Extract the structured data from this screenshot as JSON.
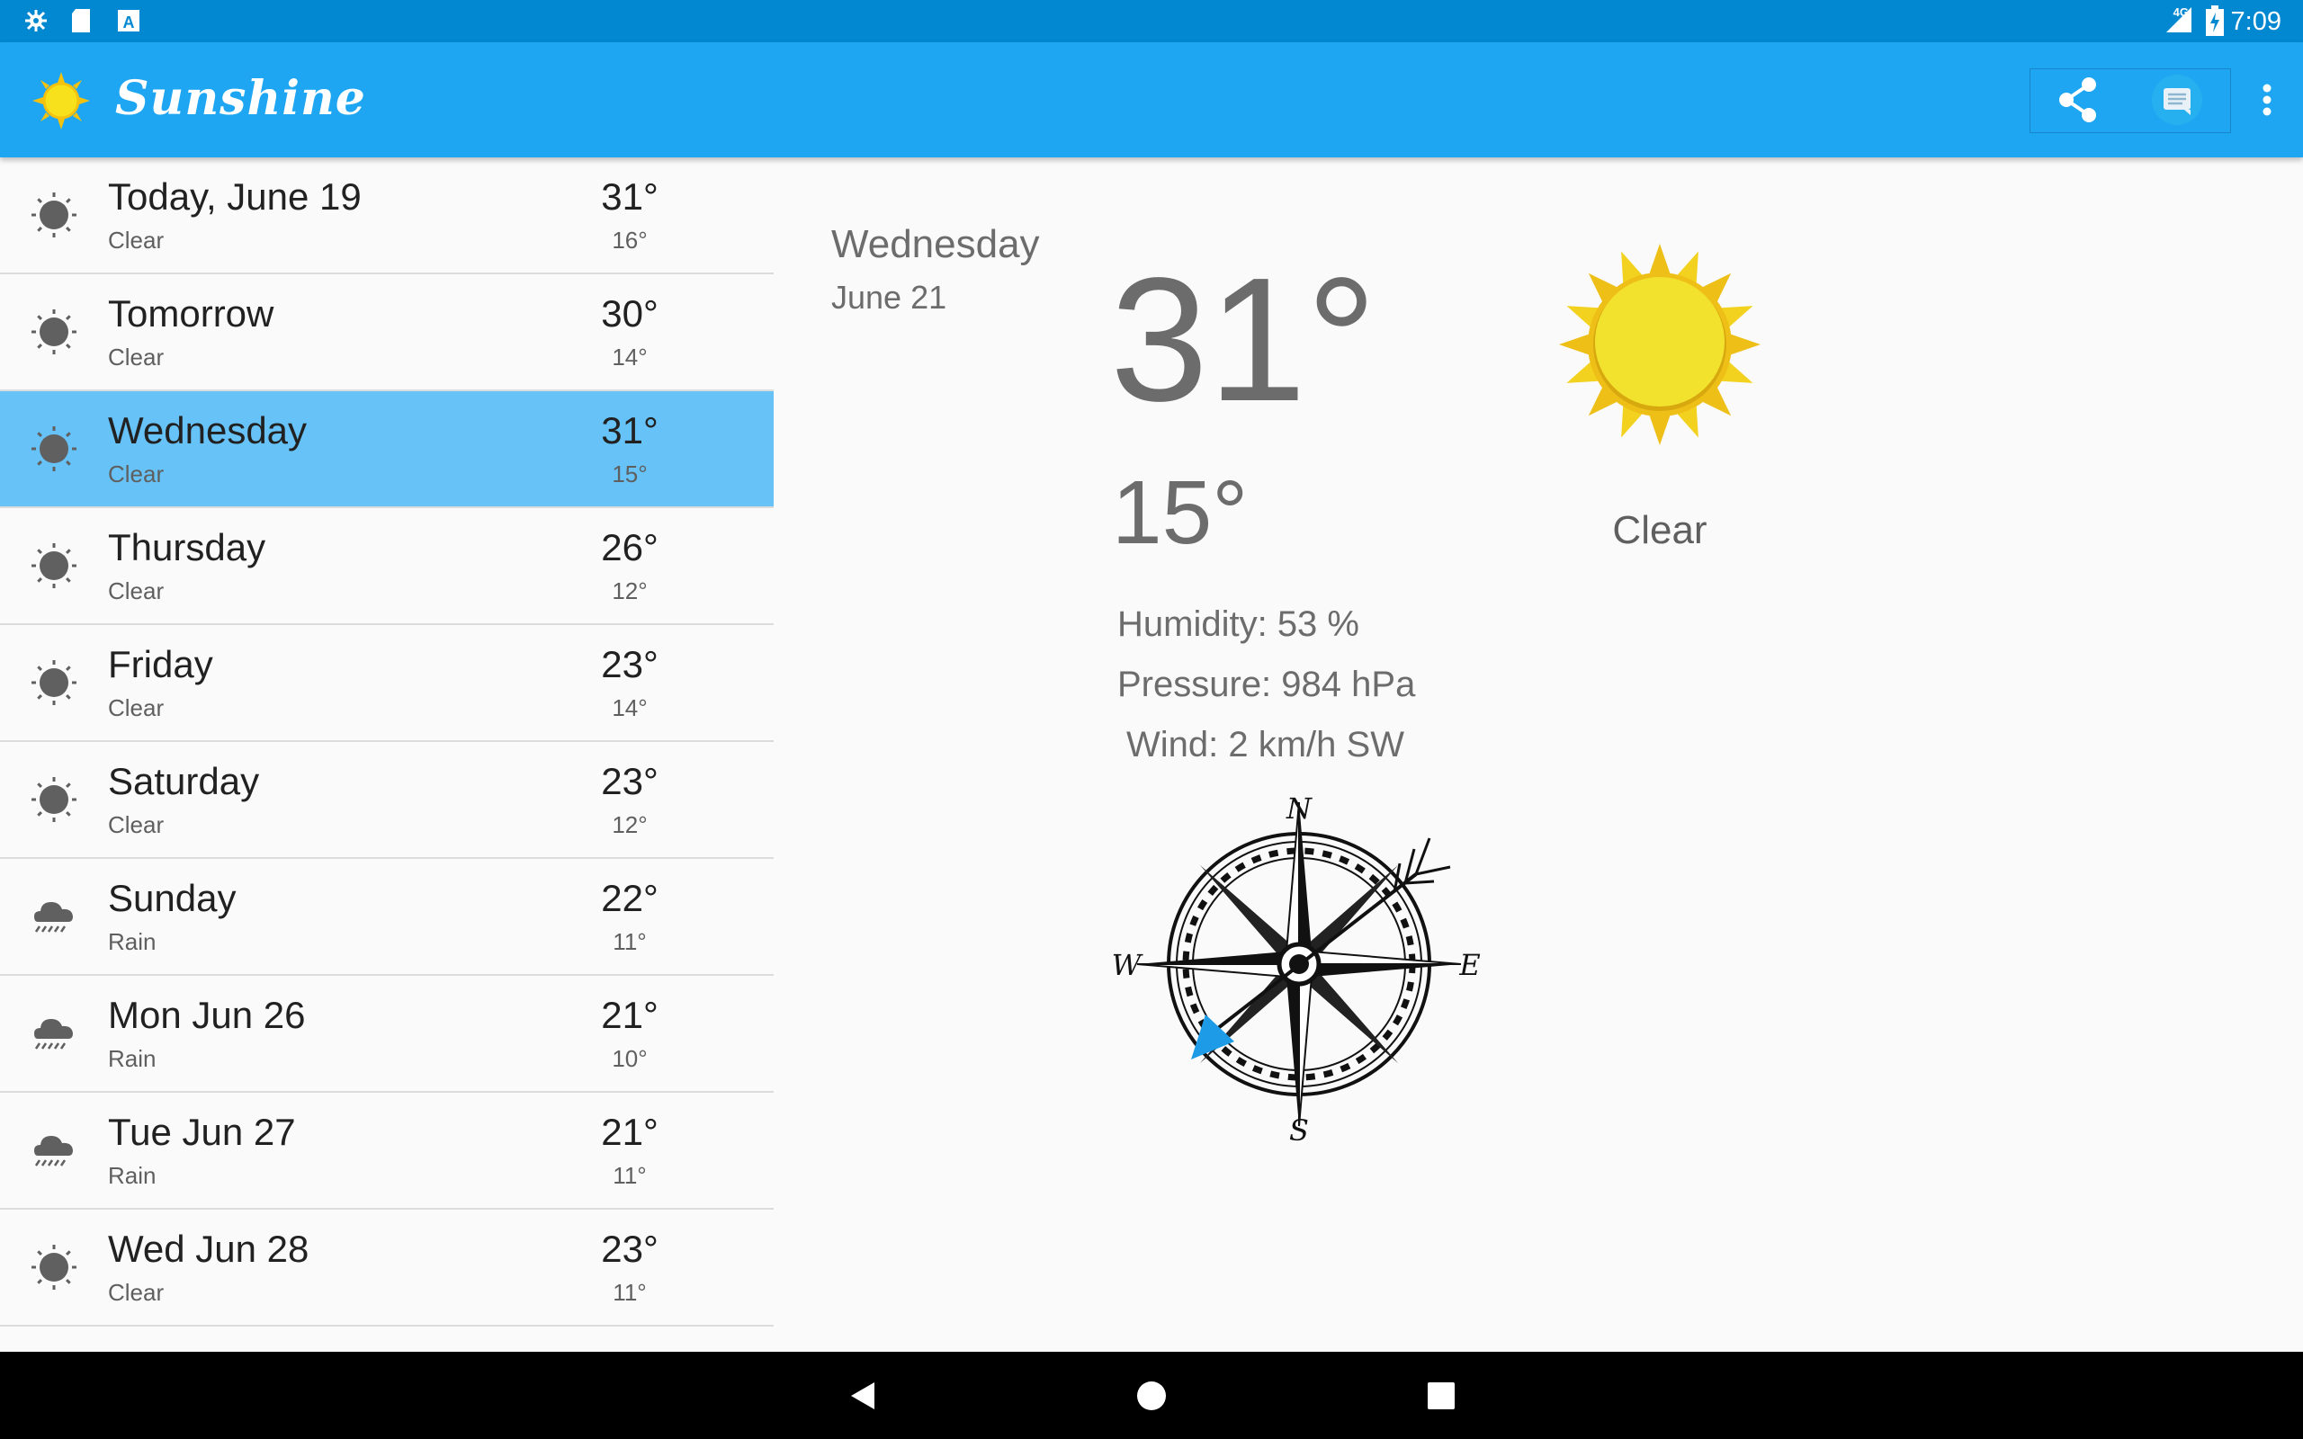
{
  "status_bar": {
    "time": "7:09",
    "network": "4G",
    "left_icons": [
      "settings-icon",
      "sd-card-icon",
      "text-a-icon"
    ],
    "right_icons": [
      "signal-icon",
      "battery-charging-icon"
    ]
  },
  "app_bar": {
    "title": "Sunshine",
    "logo_icon": "sun-logo-icon",
    "actions": [
      "share-icon",
      "message-icon",
      "more-vert-icon"
    ],
    "color": "#1ea6f2"
  },
  "forecast": [
    {
      "day": "Today, June 19",
      "condition": "Clear",
      "high": "31°",
      "low": "16°",
      "icon": "clear-icon",
      "selected": false
    },
    {
      "day": "Tomorrow",
      "condition": "Clear",
      "high": "30°",
      "low": "14°",
      "icon": "clear-icon",
      "selected": false
    },
    {
      "day": "Wednesday",
      "condition": "Clear",
      "high": "31°",
      "low": "15°",
      "icon": "clear-icon",
      "selected": true
    },
    {
      "day": "Thursday",
      "condition": "Clear",
      "high": "26°",
      "low": "12°",
      "icon": "clear-icon",
      "selected": false
    },
    {
      "day": "Friday",
      "condition": "Clear",
      "high": "23°",
      "low": "14°",
      "icon": "clear-icon",
      "selected": false
    },
    {
      "day": "Saturday",
      "condition": "Clear",
      "high": "23°",
      "low": "12°",
      "icon": "clear-icon",
      "selected": false
    },
    {
      "day": "Sunday",
      "condition": "Rain",
      "high": "22°",
      "low": "11°",
      "icon": "rain-icon",
      "selected": false
    },
    {
      "day": "Mon Jun 26",
      "condition": "Rain",
      "high": "21°",
      "low": "10°",
      "icon": "rain-icon",
      "selected": false
    },
    {
      "day": "Tue Jun 27",
      "condition": "Rain",
      "high": "21°",
      "low": "11°",
      "icon": "rain-icon",
      "selected": false
    },
    {
      "day": "Wed Jun 28",
      "condition": "Clear",
      "high": "23°",
      "low": "11°",
      "icon": "clear-icon",
      "selected": false
    }
  ],
  "detail": {
    "day": "Wednesday",
    "date": "June 21",
    "high": "31°",
    "low": "15°",
    "condition": "Clear",
    "humidity": "Humidity: 53 %",
    "pressure": "Pressure: 984 hPa",
    "wind": "Wind: 2 km/h SW",
    "compass": {
      "n": "N",
      "s": "S",
      "e": "E",
      "w": "W",
      "arrow_color": "#1e9be6"
    }
  },
  "nav_bar": [
    "back-icon",
    "home-icon",
    "recents-icon"
  ],
  "colors": {
    "selected_row": "#66c2f7",
    "status_bar": "#0288d1",
    "sun": "#f2e22e"
  }
}
